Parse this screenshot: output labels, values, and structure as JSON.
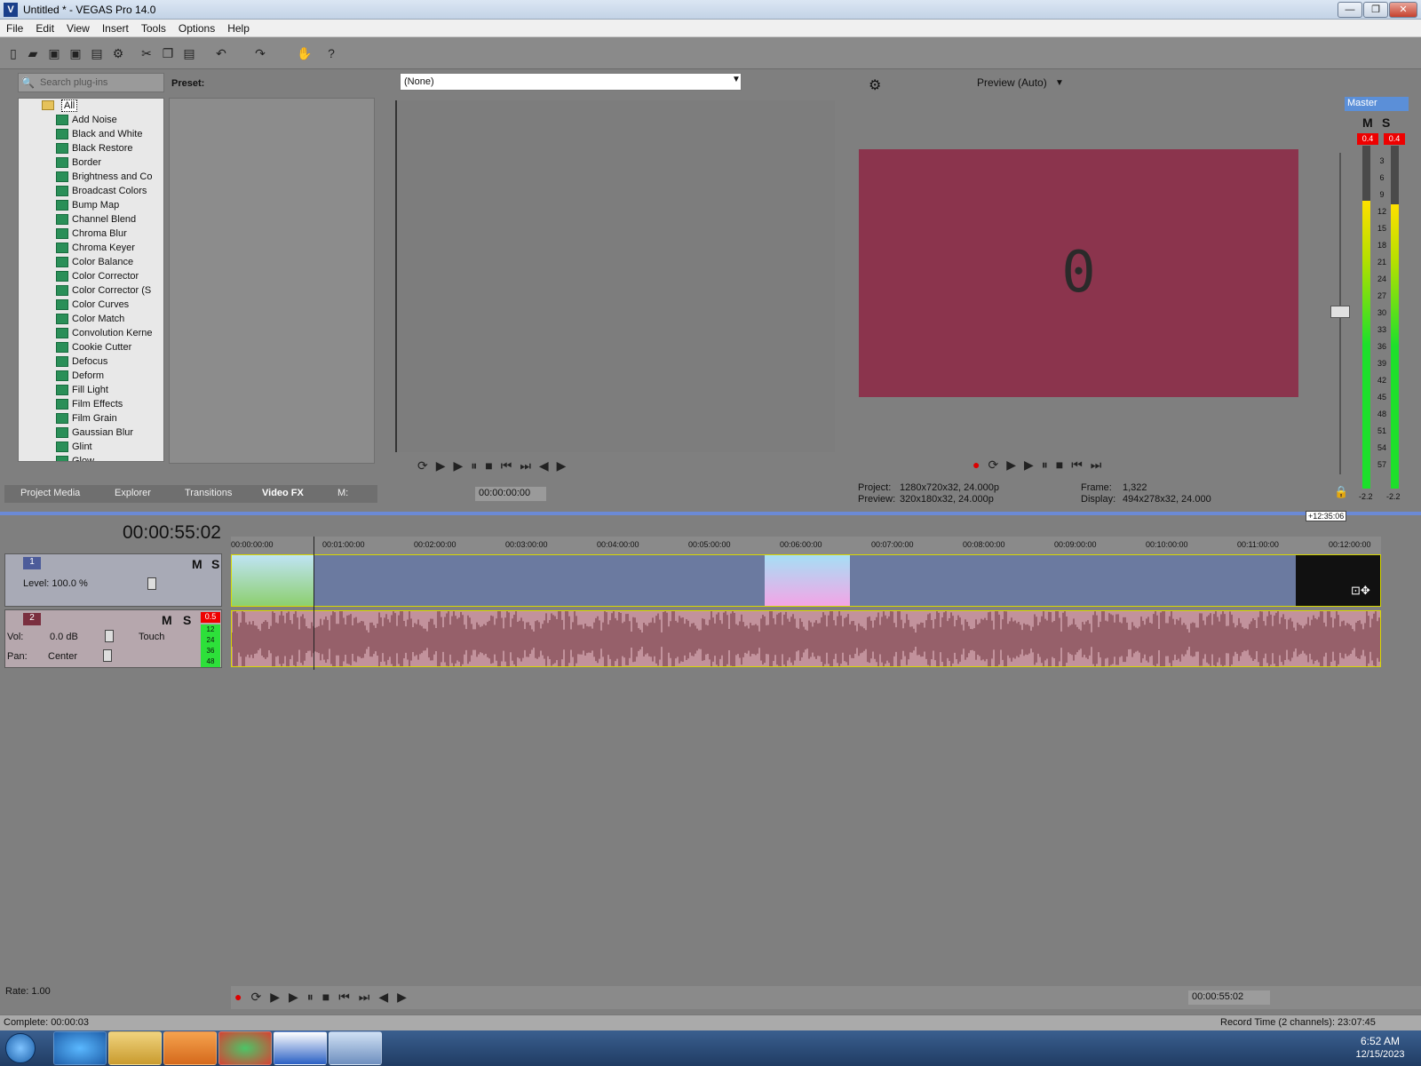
{
  "window": {
    "title": "Untitled * - VEGAS Pro 14.0",
    "app_icon": "vegas-icon",
    "min_label": "—",
    "max_label": "❐",
    "close_label": "✕"
  },
  "menu": [
    "File",
    "Edit",
    "View",
    "Insert",
    "Tools",
    "Options",
    "Help"
  ],
  "plugins": {
    "search_placeholder": "Search plug-ins",
    "root": "All",
    "items": [
      "Add Noise",
      "Black and White",
      "Black Restore",
      "Border",
      "Brightness and Co",
      "Broadcast Colors",
      "Bump Map",
      "Channel Blend",
      "Chroma Blur",
      "Chroma Keyer",
      "Color Balance",
      "Color Corrector",
      "Color Corrector (S",
      "Color Curves",
      "Color Match",
      "Convolution Kerne",
      "Cookie Cutter",
      "Defocus",
      "Deform",
      "Fill Light",
      "Film Effects",
      "Film Grain",
      "Gaussian Blur",
      "Glint",
      "Glow"
    ],
    "preset_label": "Preset:"
  },
  "tabs": [
    "Project Media",
    "Explorer",
    "Transitions",
    "Video FX",
    "M:"
  ],
  "trimmer": {
    "dropdown_value": "(None)",
    "timecode": "00:00:00:00"
  },
  "preview": {
    "mode": "Preview (Auto)",
    "frame_digit": "0",
    "frame_color": "#8b344d",
    "project_label": "Project:",
    "project_value": "1280x720x32, 24.000p",
    "preview_label": "Preview:",
    "preview_value": "320x180x32, 24.000p",
    "frame_label": "Frame:",
    "frame_value": "1,322",
    "display_label": "Display:",
    "display_value": "494x278x32, 24.000"
  },
  "master": {
    "label": "Master",
    "m": "M",
    "s": "S",
    "peak_left": "0.4",
    "peak_right": "0.4",
    "scale": [
      "3",
      "6",
      "9",
      "12",
      "15",
      "18",
      "21",
      "24",
      "27",
      "30",
      "33",
      "36",
      "39",
      "42",
      "45",
      "48",
      "51",
      "54",
      "57"
    ],
    "bottom_left": "-2.2",
    "bottom_right": "-2.2",
    "level_left": 0.84,
    "level_right": 0.83
  },
  "timeline": {
    "cursor_time": "00:00:55:02",
    "end_marker": "+12:35:06",
    "ruler": [
      "00:00:00:00",
      "00:01:00:00",
      "00:02:00:00",
      "00:03:00:00",
      "00:04:00:00",
      "00:05:00:00",
      "00:06:00:00",
      "00:07:00:00",
      "00:08:00:00",
      "00:09:00:00",
      "00:10:00:00",
      "00:11:00:00",
      "00:12:00:00"
    ],
    "video_track": {
      "number": "1",
      "level_label": "Level: 100.0 %",
      "m": "M",
      "s": "S"
    },
    "audio_track": {
      "number": "2",
      "vol_label": "Vol:",
      "vol_value": "0.0 dB",
      "pan_label": "Pan:",
      "pan_value": "Center",
      "mode": "Touch",
      "m": "M",
      "s": "S",
      "peak": "0.5",
      "meter_scale": [
        "12",
        "24",
        "36",
        "48"
      ]
    },
    "rate": "Rate: 1.00",
    "transport_time": "00:00:55:02"
  },
  "status": {
    "left": "Complete: 00:00:03",
    "right": "Record Time (2 channels): 23:07:45"
  },
  "taskbar": {
    "time": "6:52 AM",
    "date": "12/15/2023"
  }
}
